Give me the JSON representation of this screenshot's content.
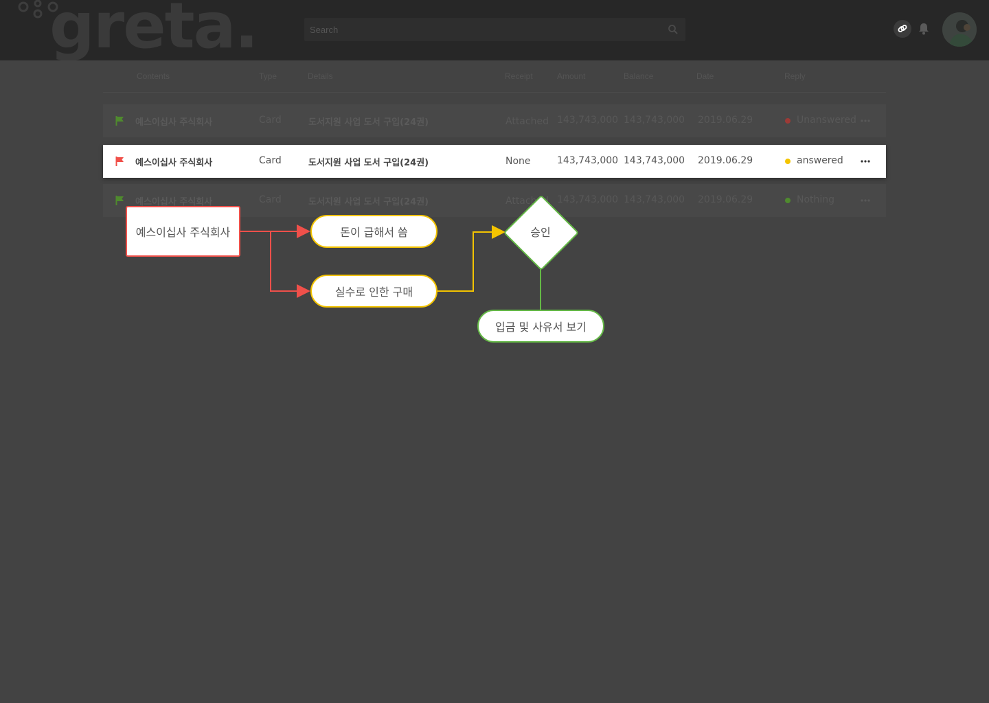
{
  "app": {
    "logo_text": "greta."
  },
  "search": {
    "placeholder": "Search"
  },
  "icons": {
    "search": "search-icon",
    "link": "link-icon",
    "bell": "bell-icon",
    "more": "more-icon",
    "flag": "flag-icon"
  },
  "table": {
    "headers": {
      "contents": "Contents",
      "type": "Type",
      "details": "Details",
      "receipt": "Receipt",
      "amount": "Amount",
      "balance": "Balance",
      "date": "Date",
      "reply": "Reply"
    },
    "rows": [
      {
        "name": "예스이십사 주식회사",
        "type": "Card",
        "details": "도서지원 사업 도서 구입(24권)",
        "receipt": "Attached",
        "amount": "143,743,000",
        "balance": "143,743,000",
        "date": "2019.06.29",
        "reply": "Unanswered",
        "flag_color": "#4f8a2e",
        "status_color": "#9c3a36"
      },
      {
        "name": "예스이십사 주식회사",
        "type": "Card",
        "details": "도서지원 사업 도서 구입(24권)",
        "receipt": "None",
        "amount": "143,743,000",
        "balance": "143,743,000",
        "date": "2019.06.29",
        "reply": "answered",
        "flag_color": "#f0504a",
        "status_color": "#f4c400"
      },
      {
        "name": "예스이십사 주식회사",
        "type": "Card",
        "details": "도서지원 사업 도서 구입(24권)",
        "receipt": "Attached",
        "amount": "143,743,000",
        "balance": "143,743,000",
        "date": "2019.06.29",
        "reply": "Nothing",
        "flag_color": "#4f8a2e",
        "status_color": "#4f8a2e"
      }
    ]
  },
  "flow": {
    "source": "예스이십사 주식회사",
    "reason_1": "돈이 급해서 씀",
    "reason_2": "실수로 인한 구매",
    "decision": "승인",
    "action": "입금 및 사유서 보기"
  },
  "colors": {
    "red": "#f0504a",
    "yellow": "#f4c400",
    "green": "#64b846"
  }
}
